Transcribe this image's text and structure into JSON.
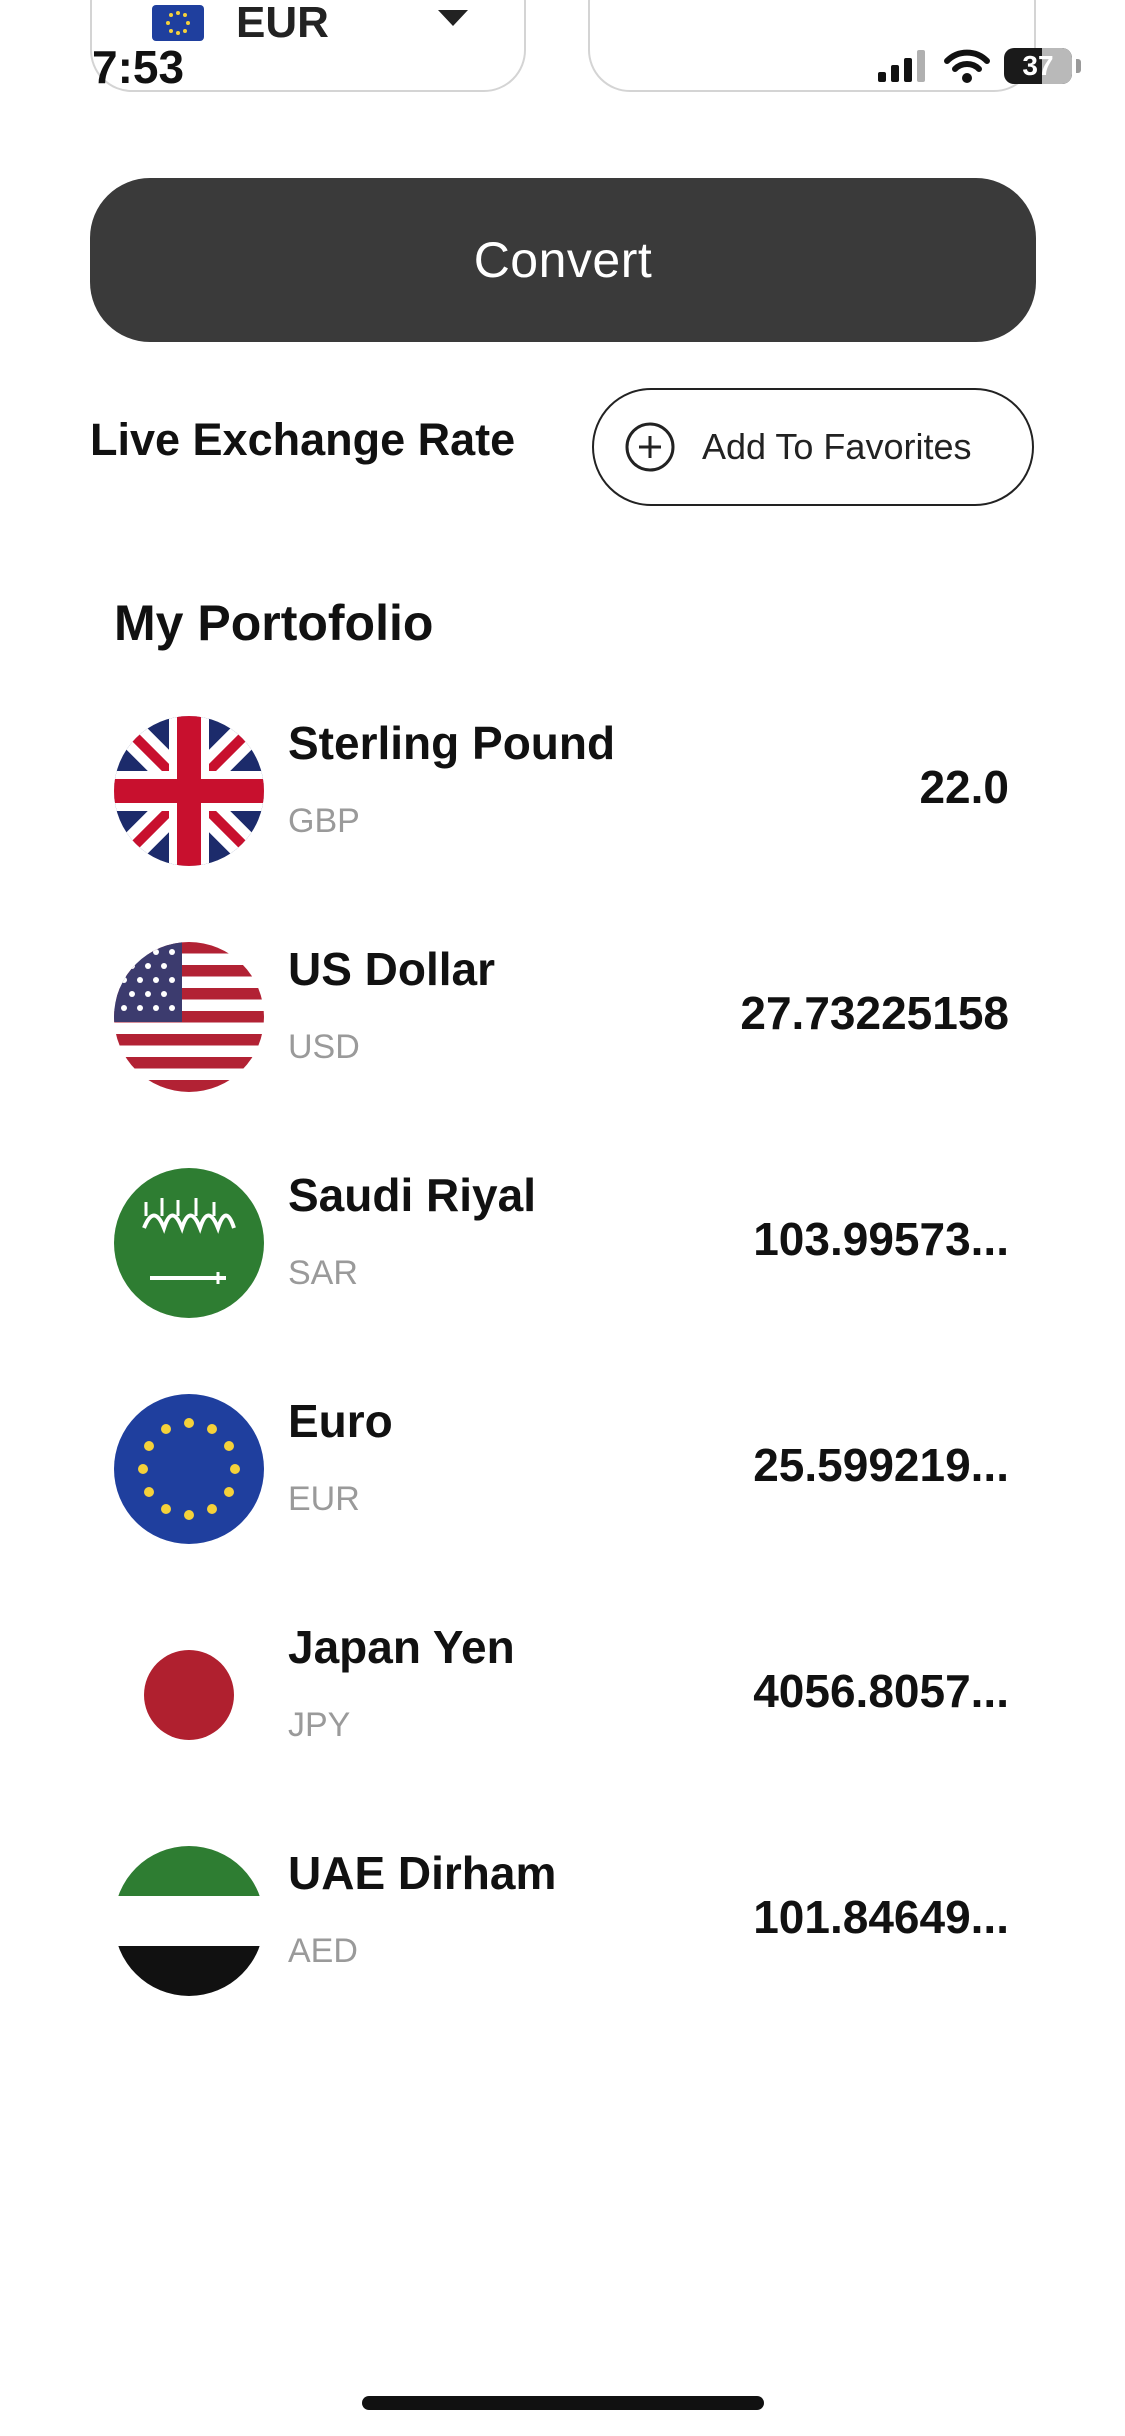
{
  "status_bar": {
    "time": "7:53",
    "battery": "37"
  },
  "top_inputs": {
    "from_currency": "EUR"
  },
  "convert": {
    "label": "Convert"
  },
  "live_rate": {
    "title": "Live Exchange Rate",
    "add_favorites_label": "Add To Favorites"
  },
  "portfolio": {
    "title": "My Portofolio",
    "items": [
      {
        "name": "Sterling Pound",
        "code": "GBP",
        "value": "22.0",
        "flag": "uk-flag-icon"
      },
      {
        "name": "US Dollar",
        "code": "USD",
        "value": "27.73225158",
        "flag": "us-flag-icon"
      },
      {
        "name": "Saudi Riyal",
        "code": "SAR",
        "value": "103.99573...",
        "flag": "saudi-flag-icon"
      },
      {
        "name": "Euro",
        "code": "EUR",
        "value": "25.599219...",
        "flag": "eu-flag-icon"
      },
      {
        "name": "Japan Yen",
        "code": "JPY",
        "value": "4056.8057...",
        "flag": "japan-flag-icon"
      },
      {
        "name": "UAE Dirham",
        "code": "AED",
        "value": "101.84649...",
        "flag": "uae-flag-icon"
      }
    ]
  },
  "colors": {
    "convert_bg": "#3a3a3a",
    "code_gray": "#9a9a9a"
  }
}
